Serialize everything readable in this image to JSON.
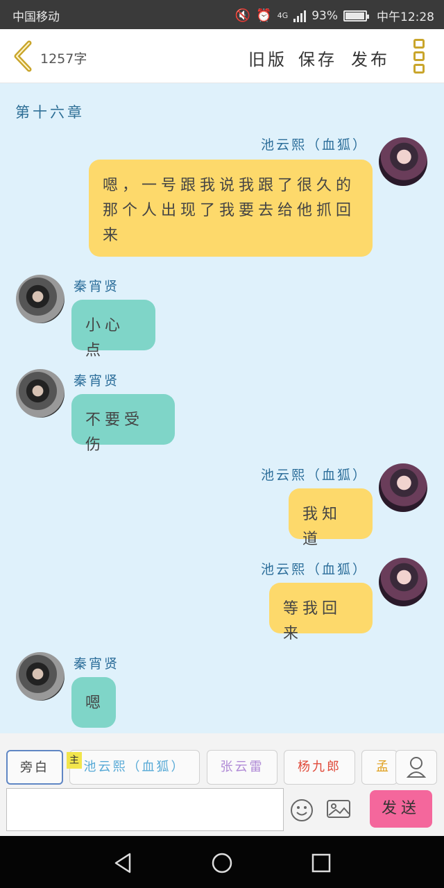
{
  "status_bar": {
    "carrier": "中国移动",
    "network": "4G",
    "battery": "93%",
    "time": "中午12:28"
  },
  "header": {
    "word_count": "1257字",
    "old_version": "旧版",
    "save": "保存",
    "publish": "发布"
  },
  "chapter_title": "第十六章",
  "messages": [
    {
      "speaker": "池云熙（血狐）",
      "side": "right",
      "text": "嗯，一号跟我说我跟了很久的那个人出现了我要去给他抓回来"
    },
    {
      "speaker": "秦宵贤",
      "side": "left",
      "text": "小心点"
    },
    {
      "speaker": "秦宵贤",
      "side": "left",
      "text": "不要受伤"
    },
    {
      "speaker": "池云熙（血狐）",
      "side": "right",
      "text": "我知道"
    },
    {
      "speaker": "池云熙（血狐）",
      "side": "right",
      "text": "等我回来"
    },
    {
      "speaker": "秦宵贤",
      "side": "left",
      "text": "嗯"
    }
  ],
  "roles": [
    {
      "label": "旁白",
      "color": "#444444",
      "selected": true
    },
    {
      "label": "池云熙（血狐）",
      "color": "#56a9d6",
      "tag": "主"
    },
    {
      "label": "张云雷",
      "color": "#b08ad6"
    },
    {
      "label": "杨九郎",
      "color": "#e04a3a"
    },
    {
      "label": "孟",
      "color": "#e0a020"
    }
  ],
  "input": {
    "value": "",
    "send_label": "发送"
  },
  "icons": {
    "mute": "mute-icon",
    "alarm": "alarm-icon",
    "back": "back-chevron-icon",
    "menu": "menu-dots-icon",
    "emoji": "emoji-icon",
    "image": "image-icon",
    "contact": "contact-icon"
  },
  "colors": {
    "chat_bg": "#dff1fb",
    "me_bubble": "#fdd96b",
    "other_bubble": "#7fd5c8",
    "send_button": "#f4679c",
    "name_color": "#2c6e9a"
  }
}
